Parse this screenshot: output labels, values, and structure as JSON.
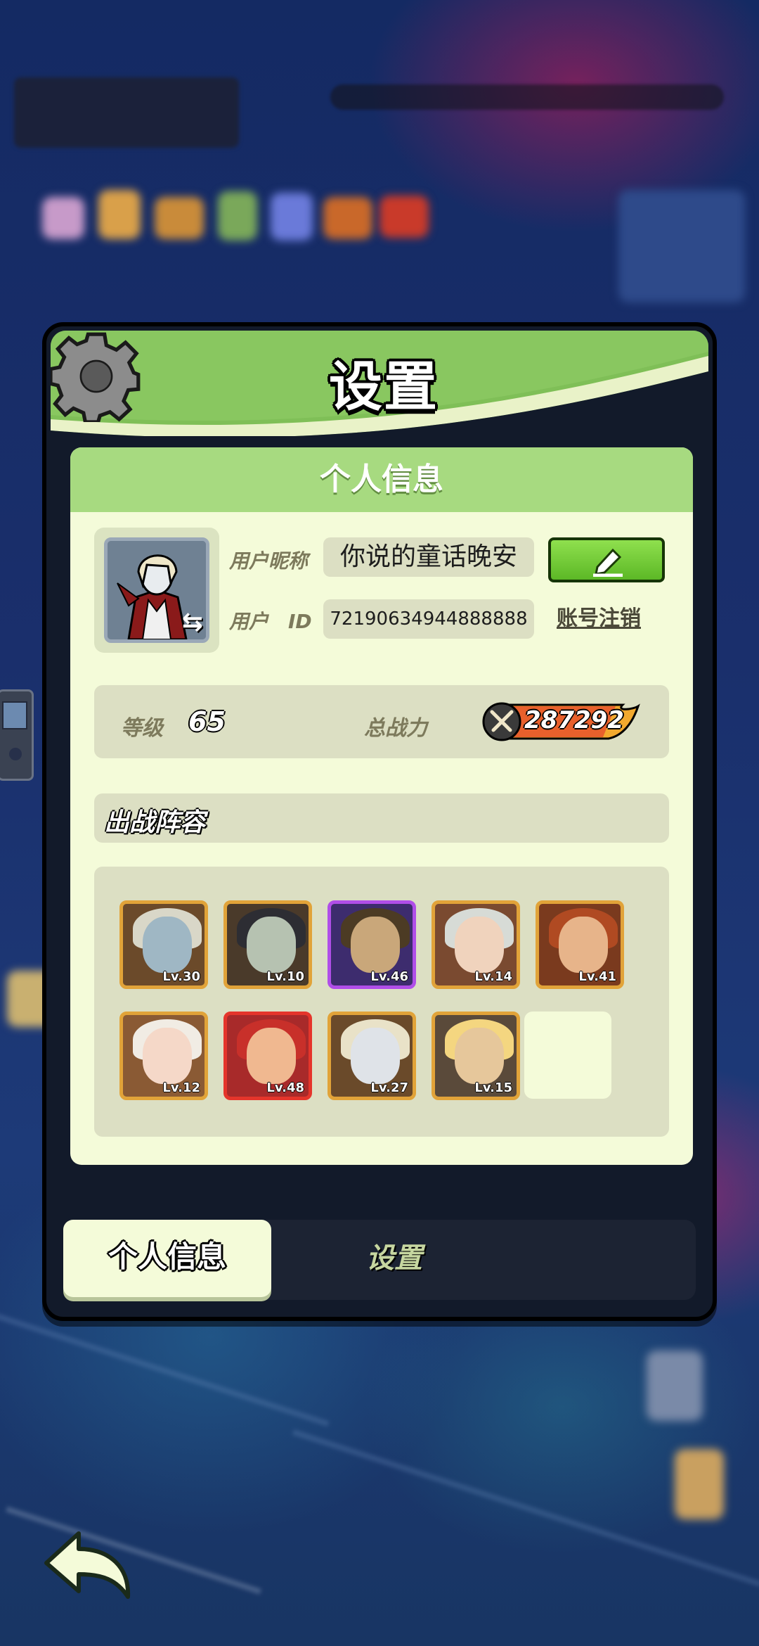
{
  "dialog": {
    "title": "设置"
  },
  "profile": {
    "section_title": "个人信息",
    "nickname_label": "用户昵称",
    "nickname": "你说的童话晚安",
    "id_label": "用户　ID",
    "user_id": "72190634944888888",
    "deregister_label": "账号注销"
  },
  "stats": {
    "level_label": "等级",
    "level": "65",
    "power_label": "总战力",
    "power": "287292"
  },
  "lineup": {
    "title": "出战阵容",
    "heroes": [
      {
        "level": "Lv.30",
        "rarity": "gold",
        "bg": "#6b4a2a",
        "skin": "#9fb7c4",
        "hair": "#d9d7c8"
      },
      {
        "level": "Lv.10",
        "rarity": "gold",
        "bg": "#4a3a2a",
        "skin": "#b6c2b1",
        "hair": "#2d2d33"
      },
      {
        "level": "Lv.46",
        "rarity": "purple",
        "bg": "#3d2c6e",
        "skin": "#c9a77a",
        "hair": "#4c3b24"
      },
      {
        "level": "Lv.14",
        "rarity": "gold",
        "bg": "#7a4a30",
        "skin": "#f0d3bd",
        "hair": "#d7dbd6"
      },
      {
        "level": "Lv.41",
        "rarity": "gold",
        "bg": "#7a3a1e",
        "skin": "#e7b48a",
        "hair": "#b04a22"
      },
      {
        "level": "Lv.12",
        "rarity": "gold",
        "bg": "#8a5a34",
        "skin": "#f5d8c8",
        "hair": "#f1ece4"
      },
      {
        "level": "Lv.48",
        "rarity": "red",
        "bg": "#a82a2a",
        "skin": "#f0b890",
        "hair": "#c8302a"
      },
      {
        "level": "Lv.27",
        "rarity": "gold",
        "bg": "#6a4a2a",
        "skin": "#dfe3e8",
        "hair": "#e9e2c8"
      },
      {
        "level": "Lv.15",
        "rarity": "gold",
        "bg": "#5a4a3a",
        "skin": "#e6c79b",
        "hair": "#f4d680"
      }
    ]
  },
  "tabs": {
    "personal": "个人信息",
    "settings": "设置"
  },
  "colors": {
    "header_green": "#7fbf57",
    "panel_bg": "#f4fbd9",
    "edit_button": "#6cc92f"
  },
  "icons": [
    "gear-icon",
    "swap-icon",
    "pencil-icon",
    "swords-icon",
    "back-arrow-icon"
  ]
}
